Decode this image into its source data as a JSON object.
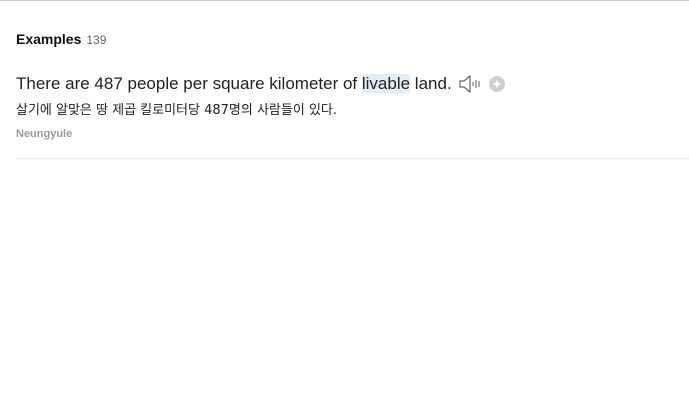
{
  "examples": {
    "title": "Examples",
    "count": "139"
  },
  "example_item": {
    "sentence_before": "There are 487 people per square kilometer of ",
    "sentence_highlight": "livable",
    "sentence_after": " land.",
    "translation": "살기에 알맞은 땅 제곱 킬로미터당 487명의 사람들이 있다.",
    "source": "Neungyule",
    "icons": {
      "speaker": "speaker-icon",
      "add": "plus-icon"
    }
  },
  "colors": {
    "highlight": "#e2edf8",
    "source_text": "#9a9a9a",
    "add_button": "#d0d0d0"
  }
}
